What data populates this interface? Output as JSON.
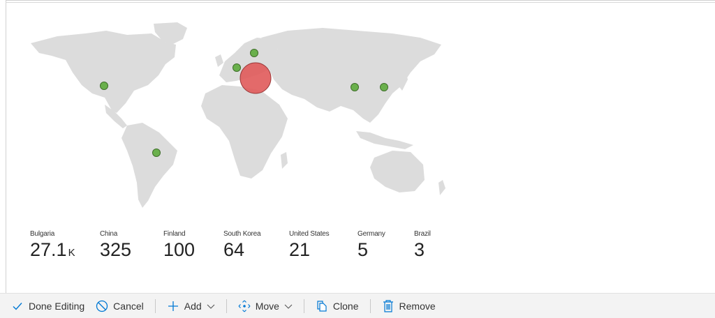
{
  "stats": [
    {
      "country": "Bulgaria",
      "value": "27.1",
      "suffix": "K"
    },
    {
      "country": "China",
      "value": "325",
      "suffix": ""
    },
    {
      "country": "Finland",
      "value": "100",
      "suffix": ""
    },
    {
      "country": "South Korea",
      "value": "64",
      "suffix": ""
    },
    {
      "country": "United States",
      "value": "21",
      "suffix": ""
    },
    {
      "country": "Germany",
      "value": "5",
      "suffix": ""
    },
    {
      "country": "Brazil",
      "value": "3",
      "suffix": ""
    }
  ],
  "toolbar": {
    "done_label": "Done Editing",
    "cancel_label": "Cancel",
    "add_label": "Add",
    "move_label": "Move",
    "clone_label": "Clone",
    "remove_label": "Remove"
  },
  "colors": {
    "accent": "#0078d4",
    "land": "#dcdcdc",
    "marker_small": "#6ab04c",
    "marker_large": "#e05a5a"
  }
}
